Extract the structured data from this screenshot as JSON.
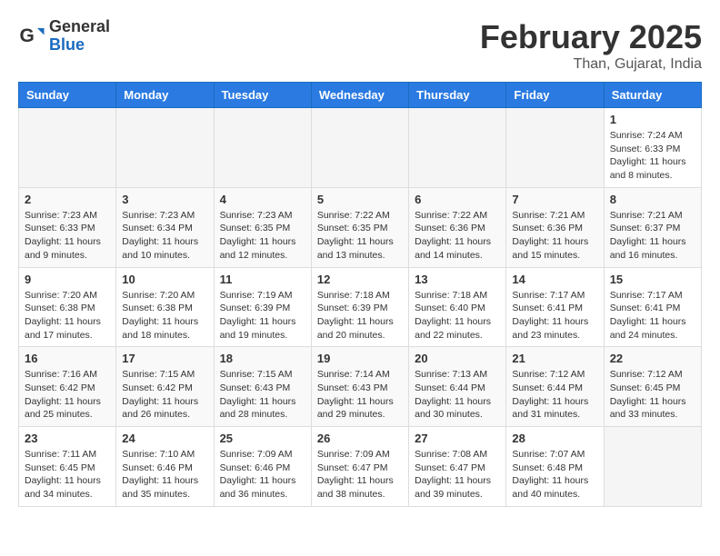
{
  "header": {
    "logo_general": "General",
    "logo_blue": "Blue",
    "month_title": "February 2025",
    "location": "Than, Gujarat, India"
  },
  "weekdays": [
    "Sunday",
    "Monday",
    "Tuesday",
    "Wednesday",
    "Thursday",
    "Friday",
    "Saturday"
  ],
  "weeks": [
    [
      {
        "day": "",
        "info": ""
      },
      {
        "day": "",
        "info": ""
      },
      {
        "day": "",
        "info": ""
      },
      {
        "day": "",
        "info": ""
      },
      {
        "day": "",
        "info": ""
      },
      {
        "day": "",
        "info": ""
      },
      {
        "day": "1",
        "info": "Sunrise: 7:24 AM\nSunset: 6:33 PM\nDaylight: 11 hours and 8 minutes."
      }
    ],
    [
      {
        "day": "2",
        "info": "Sunrise: 7:23 AM\nSunset: 6:33 PM\nDaylight: 11 hours and 9 minutes."
      },
      {
        "day": "3",
        "info": "Sunrise: 7:23 AM\nSunset: 6:34 PM\nDaylight: 11 hours and 10 minutes."
      },
      {
        "day": "4",
        "info": "Sunrise: 7:23 AM\nSunset: 6:35 PM\nDaylight: 11 hours and 12 minutes."
      },
      {
        "day": "5",
        "info": "Sunrise: 7:22 AM\nSunset: 6:35 PM\nDaylight: 11 hours and 13 minutes."
      },
      {
        "day": "6",
        "info": "Sunrise: 7:22 AM\nSunset: 6:36 PM\nDaylight: 11 hours and 14 minutes."
      },
      {
        "day": "7",
        "info": "Sunrise: 7:21 AM\nSunset: 6:36 PM\nDaylight: 11 hours and 15 minutes."
      },
      {
        "day": "8",
        "info": "Sunrise: 7:21 AM\nSunset: 6:37 PM\nDaylight: 11 hours and 16 minutes."
      }
    ],
    [
      {
        "day": "9",
        "info": "Sunrise: 7:20 AM\nSunset: 6:38 PM\nDaylight: 11 hours and 17 minutes."
      },
      {
        "day": "10",
        "info": "Sunrise: 7:20 AM\nSunset: 6:38 PM\nDaylight: 11 hours and 18 minutes."
      },
      {
        "day": "11",
        "info": "Sunrise: 7:19 AM\nSunset: 6:39 PM\nDaylight: 11 hours and 19 minutes."
      },
      {
        "day": "12",
        "info": "Sunrise: 7:18 AM\nSunset: 6:39 PM\nDaylight: 11 hours and 20 minutes."
      },
      {
        "day": "13",
        "info": "Sunrise: 7:18 AM\nSunset: 6:40 PM\nDaylight: 11 hours and 22 minutes."
      },
      {
        "day": "14",
        "info": "Sunrise: 7:17 AM\nSunset: 6:41 PM\nDaylight: 11 hours and 23 minutes."
      },
      {
        "day": "15",
        "info": "Sunrise: 7:17 AM\nSunset: 6:41 PM\nDaylight: 11 hours and 24 minutes."
      }
    ],
    [
      {
        "day": "16",
        "info": "Sunrise: 7:16 AM\nSunset: 6:42 PM\nDaylight: 11 hours and 25 minutes."
      },
      {
        "day": "17",
        "info": "Sunrise: 7:15 AM\nSunset: 6:42 PM\nDaylight: 11 hours and 26 minutes."
      },
      {
        "day": "18",
        "info": "Sunrise: 7:15 AM\nSunset: 6:43 PM\nDaylight: 11 hours and 28 minutes."
      },
      {
        "day": "19",
        "info": "Sunrise: 7:14 AM\nSunset: 6:43 PM\nDaylight: 11 hours and 29 minutes."
      },
      {
        "day": "20",
        "info": "Sunrise: 7:13 AM\nSunset: 6:44 PM\nDaylight: 11 hours and 30 minutes."
      },
      {
        "day": "21",
        "info": "Sunrise: 7:12 AM\nSunset: 6:44 PM\nDaylight: 11 hours and 31 minutes."
      },
      {
        "day": "22",
        "info": "Sunrise: 7:12 AM\nSunset: 6:45 PM\nDaylight: 11 hours and 33 minutes."
      }
    ],
    [
      {
        "day": "23",
        "info": "Sunrise: 7:11 AM\nSunset: 6:45 PM\nDaylight: 11 hours and 34 minutes."
      },
      {
        "day": "24",
        "info": "Sunrise: 7:10 AM\nSunset: 6:46 PM\nDaylight: 11 hours and 35 minutes."
      },
      {
        "day": "25",
        "info": "Sunrise: 7:09 AM\nSunset: 6:46 PM\nDaylight: 11 hours and 36 minutes."
      },
      {
        "day": "26",
        "info": "Sunrise: 7:09 AM\nSunset: 6:47 PM\nDaylight: 11 hours and 38 minutes."
      },
      {
        "day": "27",
        "info": "Sunrise: 7:08 AM\nSunset: 6:47 PM\nDaylight: 11 hours and 39 minutes."
      },
      {
        "day": "28",
        "info": "Sunrise: 7:07 AM\nSunset: 6:48 PM\nDaylight: 11 hours and 40 minutes."
      },
      {
        "day": "",
        "info": ""
      }
    ]
  ]
}
